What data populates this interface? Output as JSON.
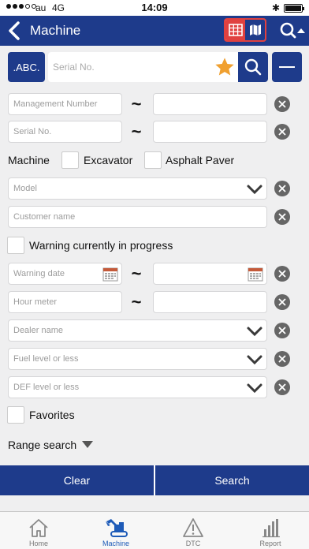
{
  "status_bar": {
    "carrier": "au",
    "network": "4G",
    "time": "14:09",
    "battery_percent": 100
  },
  "header": {
    "title": "Machine"
  },
  "search": {
    "mode_label": ".ABC.",
    "placeholder": "Serial No."
  },
  "form": {
    "management_from_placeholder": "Management Number",
    "serial_from_placeholder": "Serial No.",
    "range_separator": "~",
    "machine_label": "Machine",
    "excavator_label": "Excavator",
    "asphalt_paver_label": "Asphalt Paver",
    "model_placeholder": "Model",
    "customer_placeholder": "Customer name",
    "warning_in_progress_label": "Warning currently in progress",
    "warning_date_placeholder": "Warning date",
    "hour_meter_placeholder": "Hour meter",
    "dealer_placeholder": "Dealer name",
    "fuel_placeholder": "Fuel level or less",
    "def_placeholder": "DEF level or less",
    "favorites_label": "Favorites",
    "range_search_label": "Range search"
  },
  "actions": {
    "clear_label": "Clear",
    "search_label": "Search"
  },
  "tabs": [
    {
      "label": "Home",
      "icon": "home-icon",
      "active": false
    },
    {
      "label": "Machine",
      "icon": "excavator-icon",
      "active": true
    },
    {
      "label": "DTC",
      "icon": "warning-icon",
      "active": false
    },
    {
      "label": "Report",
      "icon": "bar-chart-icon",
      "active": false
    }
  ],
  "colors": {
    "primary": "#1e3b8b",
    "accent_red": "#e04140",
    "star": "#f0a030",
    "active_tab": "#1e5bb8"
  }
}
